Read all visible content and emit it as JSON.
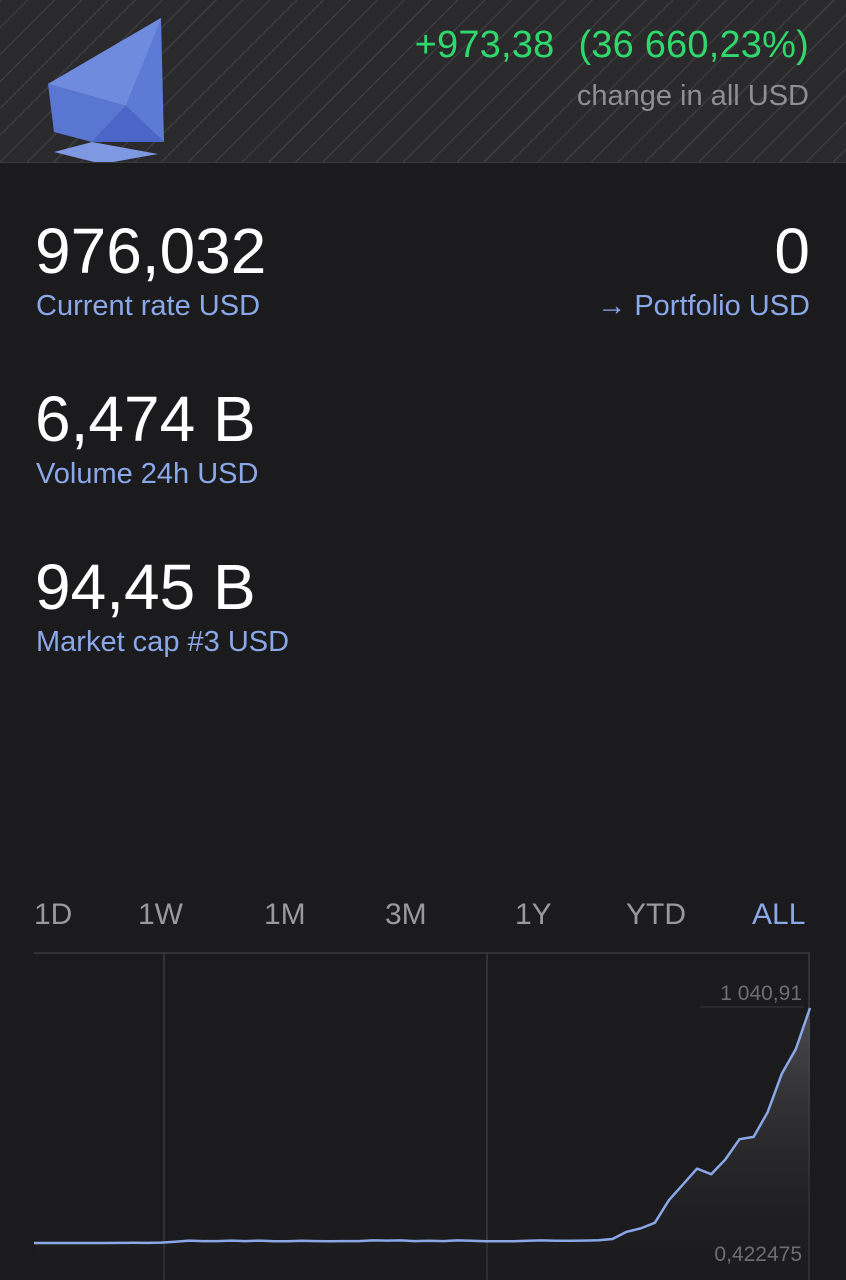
{
  "header": {
    "logo_icon": "ethereum-diamond-icon",
    "change_absolute": "+973,38",
    "change_percent": "(36 660,23%)",
    "change_caption": "change in all USD"
  },
  "stats": {
    "current_rate": {
      "value": "976,032",
      "label": "Current rate USD"
    },
    "portfolio": {
      "value": "0",
      "label": "→ Portfolio USD"
    },
    "volume": {
      "value": "6,474 B",
      "label": "Volume 24h USD"
    },
    "market_cap": {
      "value": "94,45 B",
      "label": "Market cap #3 USD"
    }
  },
  "ranges": {
    "tabs": [
      "1D",
      "1W",
      "1M",
      "3M",
      "1Y",
      "YTD",
      "ALL"
    ],
    "selected": "ALL"
  },
  "chart": {
    "max_label": "1 040,91",
    "min_label": "0,422475"
  },
  "chart_data": {
    "type": "area",
    "xlabel": "",
    "ylabel": "",
    "ylim": [
      0.422475,
      1040.91
    ],
    "grid": "vertical",
    "series": [
      {
        "values": [
          0.42,
          0.42,
          0.42,
          0.42,
          0.42,
          0.42,
          1,
          1.5,
          1,
          2,
          6,
          11,
          9,
          9,
          11,
          9,
          11,
          8,
          8,
          10,
          9,
          8,
          9,
          9,
          12,
          11,
          12,
          9,
          10,
          9,
          12,
          10,
          8,
          8,
          8,
          10,
          12,
          10,
          10,
          11,
          13,
          18,
          50,
          65,
          90,
          190,
          260,
          330,
          305,
          370,
          460,
          470,
          580,
          750,
          860,
          1040.91
        ]
      }
    ],
    "colors": {
      "line": "#8aa7e8",
      "fill_top": "#4e4e52",
      "fill_bottom": "#1b1b1d"
    }
  },
  "theme": {
    "background": "#1b1b1d",
    "accent": "#8aa7e8",
    "positive": "#2fd86b",
    "muted": "#8e8e93"
  }
}
